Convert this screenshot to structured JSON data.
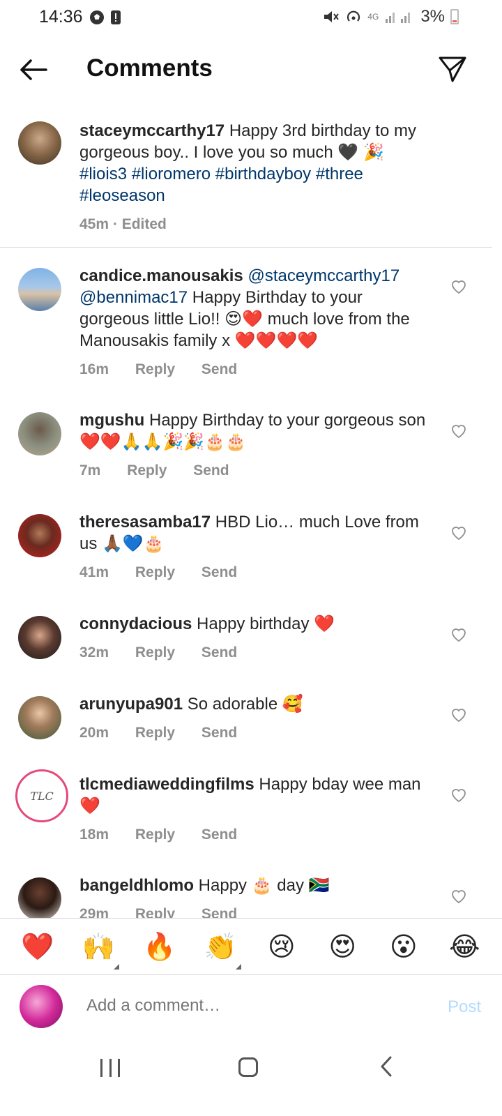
{
  "status_bar": {
    "time": "14:36",
    "battery": "3%",
    "network": "4G",
    "icons": [
      "soccer-ball-icon",
      "alert-icon",
      "mute-icon",
      "hotspot-icon",
      "signal-icon",
      "battery-icon"
    ]
  },
  "header": {
    "title": "Comments"
  },
  "caption": {
    "username": "staceymccarthy17",
    "text_plain": "Happy 3rd birthday to my gorgeous boy.. I love you so much 🖤 🎉 ",
    "hashtags": "#liois3 #lioromero #birthdayboy #three #leoseason",
    "time": "45m",
    "edited": "Edited"
  },
  "comments": [
    {
      "username": "candice.manousakis",
      "mentions": "@staceymccarthy17 @bennimac17",
      "text": " Happy Birthday to your gorgeous little Lio!! 😍❤️ much love from the Manousakis family x ❤️❤️❤️❤️",
      "time": "16m",
      "reply": "Reply",
      "send": "Send"
    },
    {
      "username": "mgushu",
      "text": " Happy Birthday to your gorgeous son ❤️❤️🙏🙏🎉🎉🎂🎂",
      "time": "7m",
      "reply": "Reply",
      "send": "Send"
    },
    {
      "username": "theresasamba17",
      "text": " HBD Lio… much Love from us 🙏🏾💙🎂",
      "time": "41m",
      "reply": "Reply",
      "send": "Send"
    },
    {
      "username": "connydacious",
      "text": " Happy birthday ❤️",
      "time": "32m",
      "reply": "Reply",
      "send": "Send"
    },
    {
      "username": "arunyupa901",
      "text": " So adorable 🥰",
      "time": "20m",
      "reply": "Reply",
      "send": "Send"
    },
    {
      "username": "tlcmediaweddingfilms",
      "text": " Happy bday wee man ❤️",
      "time": "18m",
      "reply": "Reply",
      "send": "Send"
    },
    {
      "username": "bangeldhlomo",
      "text": " Happy 🎂 day 🇿🇦",
      "time": "29m",
      "reply": "Reply",
      "send": "Send"
    }
  ],
  "reactions": [
    "❤️",
    "🙌",
    "🔥",
    "👏",
    "😢",
    "😍",
    "😮",
    "😂"
  ],
  "composer": {
    "placeholder": "Add a comment…",
    "post_label": "Post"
  },
  "colors": {
    "link": "#00376b",
    "meta": "#8e8e8e",
    "post_disabled": "#b3dbff",
    "divider": "#dbdbdb"
  }
}
